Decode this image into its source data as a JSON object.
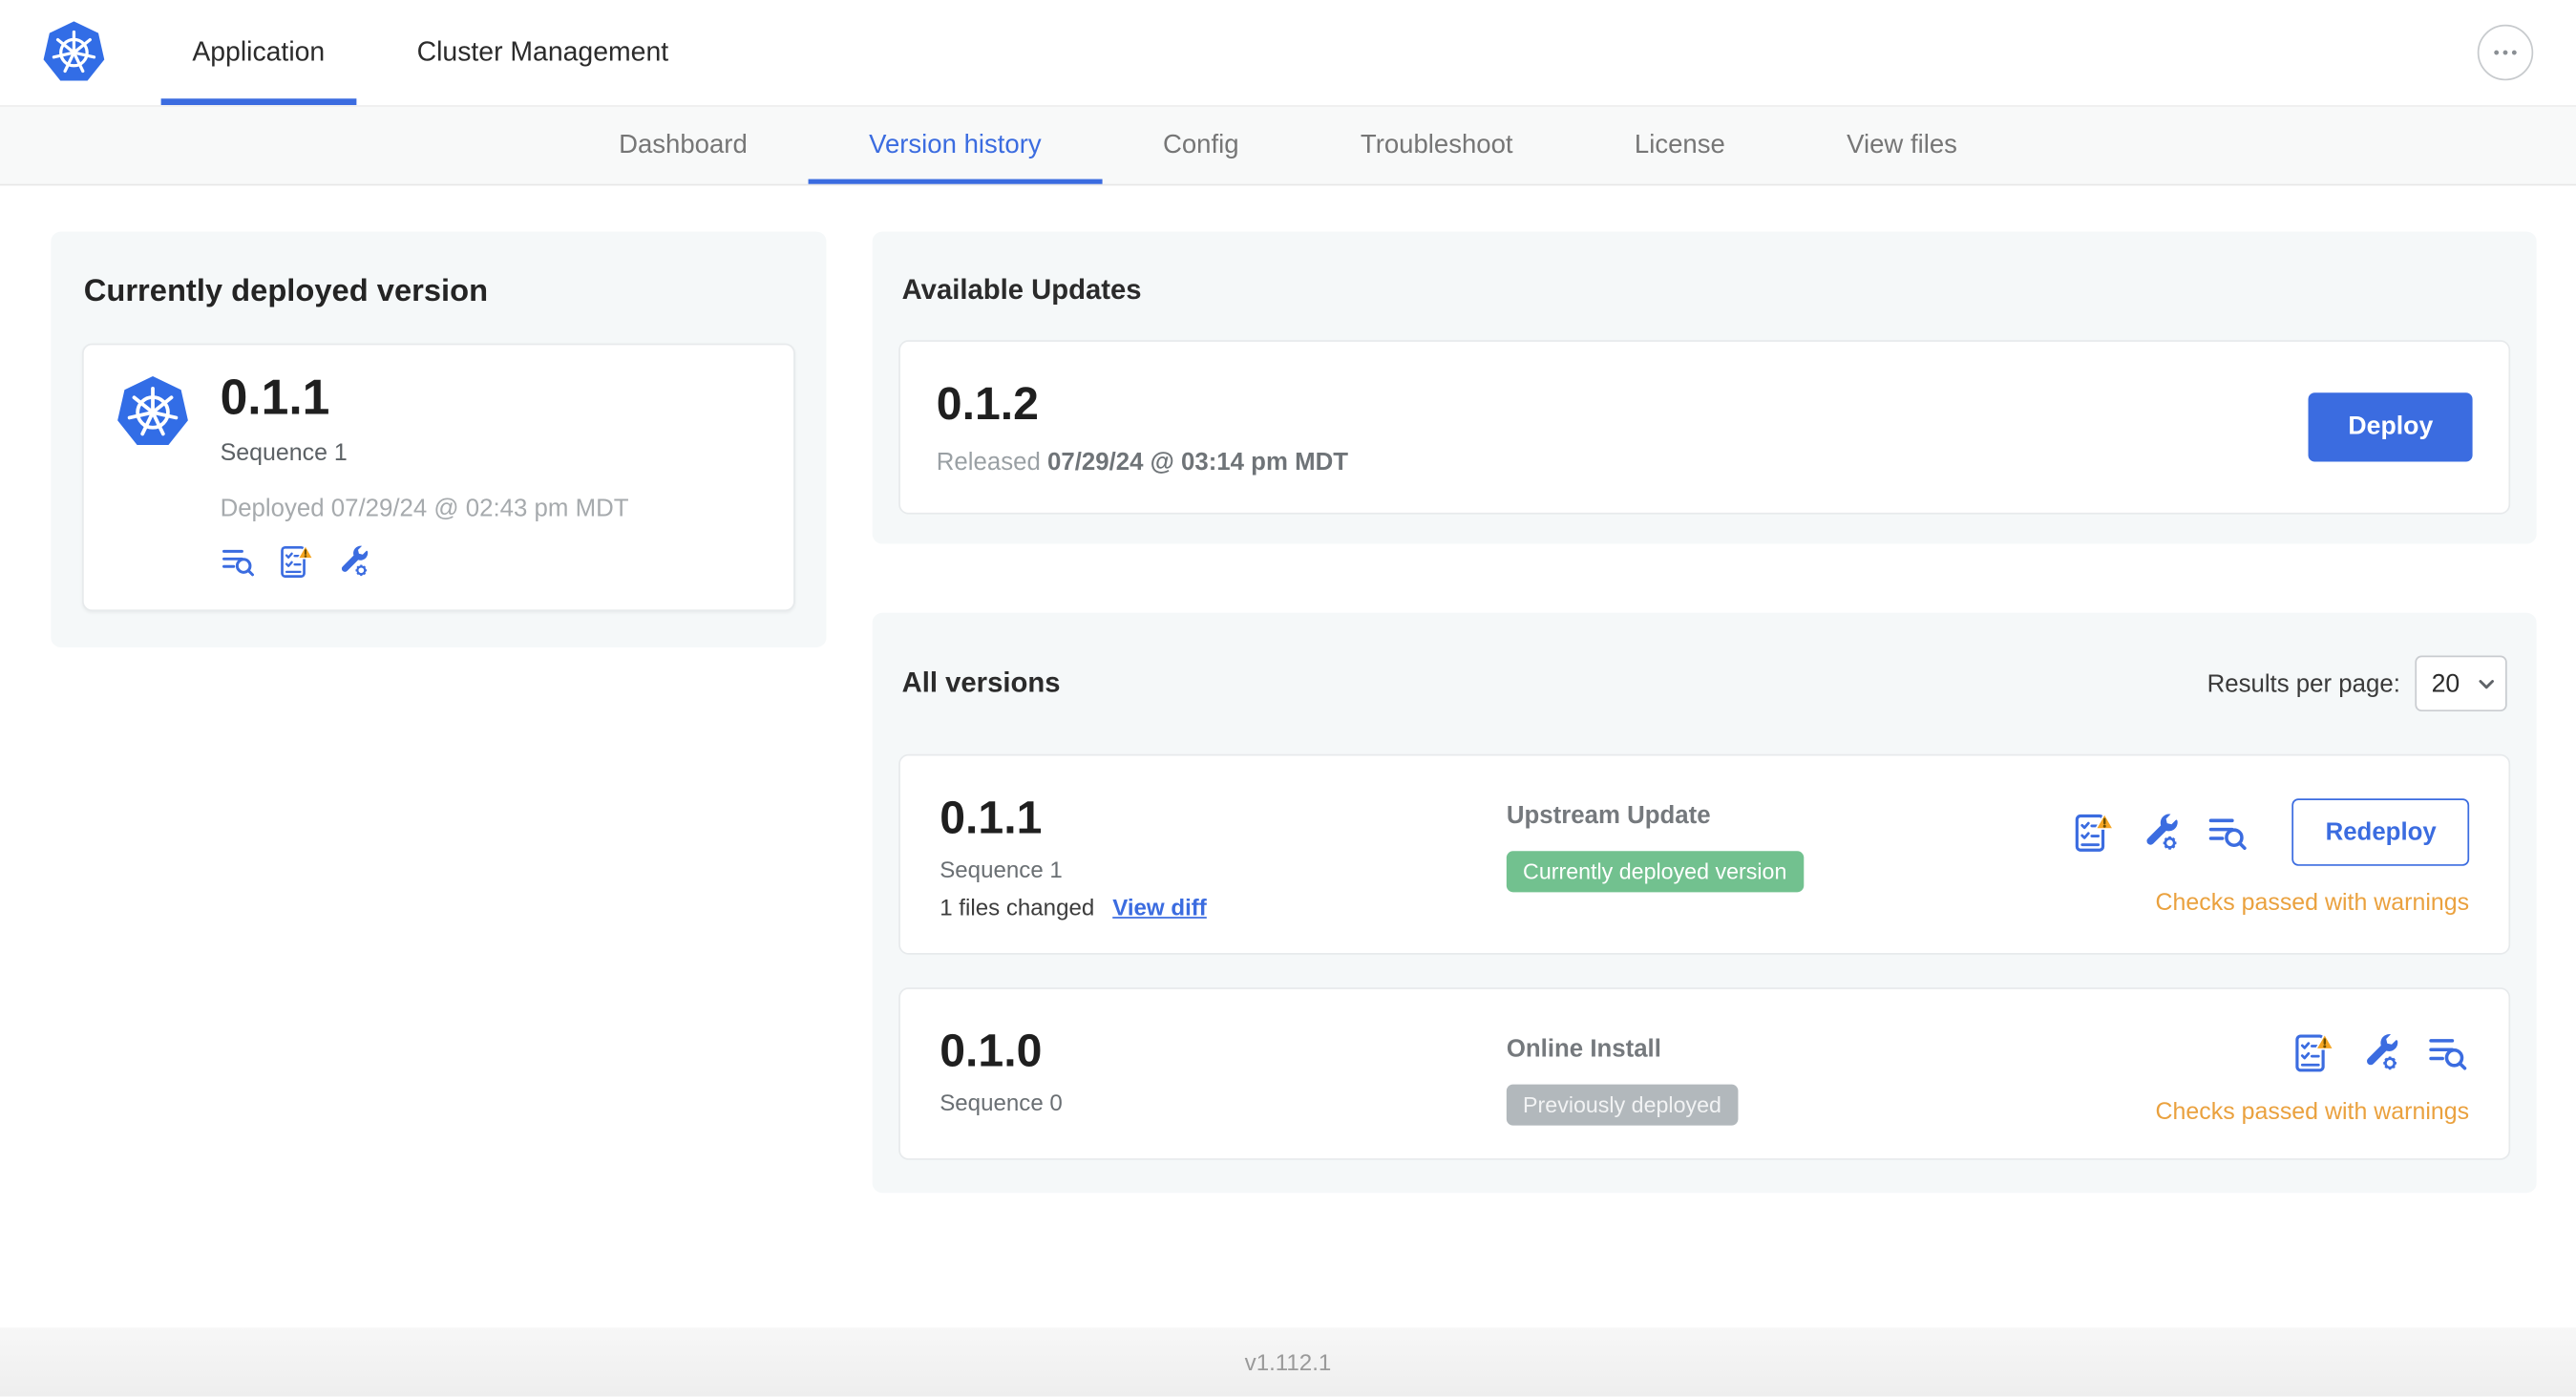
{
  "colors": {
    "accent": "#3b6ce0",
    "k8s_blue": "#326de6",
    "warning_text": "#eaa13e",
    "warning_triangle": "#f5a623",
    "badge_green_bg": "#72c18f",
    "badge_gray_bg": "#b2b8bc"
  },
  "top_nav": {
    "items": [
      {
        "label": "Application"
      },
      {
        "label": "Cluster Management"
      }
    ],
    "active": "Application",
    "more_icon": "ellipsis-icon"
  },
  "sub_nav": {
    "items": [
      {
        "label": "Dashboard"
      },
      {
        "label": "Version history"
      },
      {
        "label": "Config"
      },
      {
        "label": "Troubleshoot"
      },
      {
        "label": "License"
      },
      {
        "label": "View files"
      }
    ],
    "active": "Version history"
  },
  "currently_deployed": {
    "title": "Currently deployed version",
    "version": "0.1.1",
    "sequence": "Sequence 1",
    "deployed_at": "Deployed 07/29/24 @ 02:43 pm MDT",
    "icons": [
      "logs-icon",
      "preflight-checks-warning-icon",
      "config-icon"
    ]
  },
  "available_updates": {
    "title": "Available Updates",
    "version": "0.1.2",
    "released_label": "Released",
    "released_at": "07/29/24 @ 03:14 pm MDT",
    "deploy_button": "Deploy"
  },
  "all_versions": {
    "title": "All versions",
    "results_per_page_label": "Results per page:",
    "results_per_page_value": "20",
    "rows": [
      {
        "version": "0.1.1",
        "sequence": "Sequence 1",
        "files_changed": "1 files changed",
        "view_diff": "View diff",
        "source": "Upstream Update",
        "badge": "Currently deployed version",
        "badge_style": "green",
        "action": "Redeploy",
        "checks": "Checks passed with warnings",
        "icons": [
          "preflight-checks-warning-icon",
          "config-icon",
          "logs-icon"
        ]
      },
      {
        "version": "0.1.0",
        "sequence": "Sequence 0",
        "source": "Online Install",
        "badge": "Previously deployed",
        "badge_style": "gray",
        "checks": "Checks passed with warnings",
        "icons": [
          "preflight-checks-warning-icon",
          "config-icon",
          "logs-icon"
        ]
      }
    ]
  },
  "footer": {
    "app_version": "v1.112.1"
  }
}
